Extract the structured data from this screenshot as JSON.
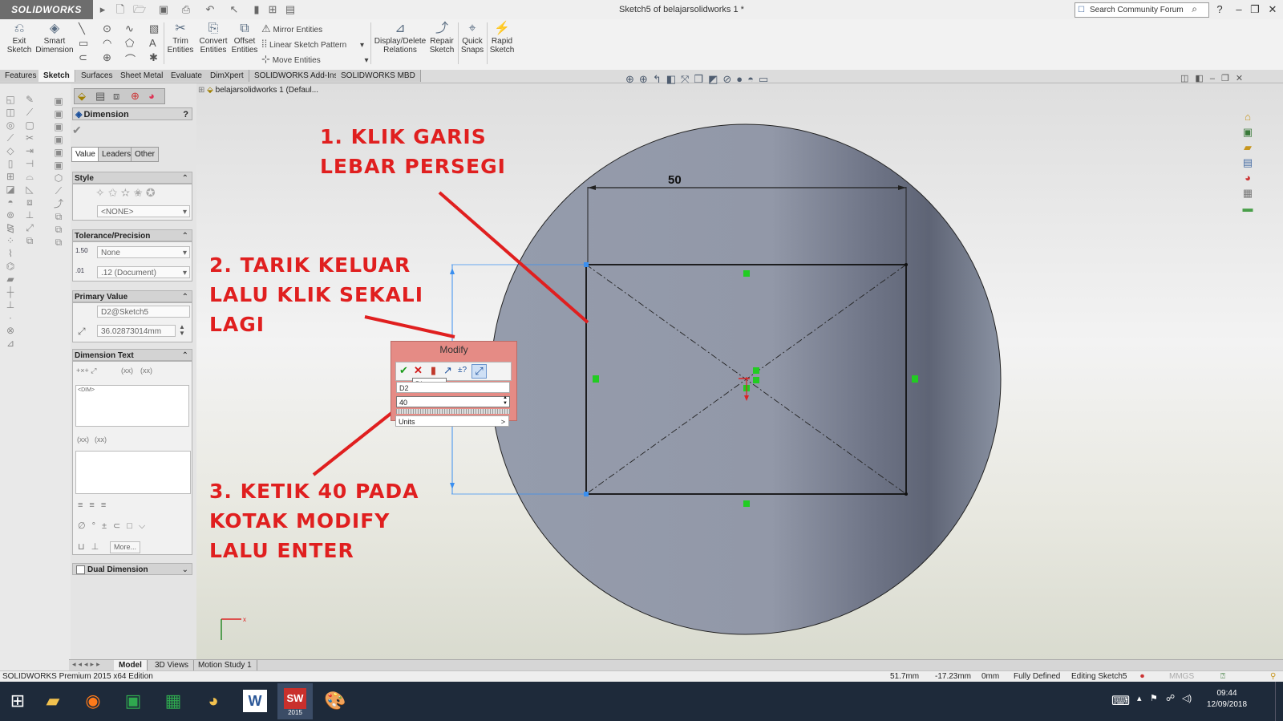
{
  "app": {
    "logo": "SOLIDWORKS",
    "doc_title": "Sketch5 of belajarsolidworks 1 *"
  },
  "search": {
    "placeholder": "Search Community Forum"
  },
  "toolbar": {
    "exit_sketch": "Exit Sketch",
    "smart_dimension": "Smart Dimension",
    "trim_entities": "Trim Entities",
    "convert_entities": "Convert Entities",
    "offset_entities": "Offset Entities",
    "mirror_entities": "Mirror Entities",
    "linear_sketch_pattern": "Linear Sketch Pattern",
    "move_entities": "Move Entities",
    "display_delete_relations": "Display/Delete Relations",
    "repair_sketch": "Repair Sketch",
    "quick_snaps": "Quick Snaps",
    "rapid_sketch": "Rapid Sketch"
  },
  "tabs": [
    "Features",
    "Sketch",
    "Surfaces",
    "Sheet Metal",
    "Evaluate",
    "DimXpert",
    "SOLIDWORKS Add-Ins",
    "SOLIDWORKS MBD"
  ],
  "tree": {
    "root": "belajarsolidworks 1  (Defaul..."
  },
  "pm": {
    "title": "Dimension",
    "help": "?",
    "tabs": [
      "Value",
      "Leaders",
      "Other"
    ],
    "style": {
      "header": "Style",
      "value": "<NONE>"
    },
    "tolerance": {
      "header": "Tolerance/Precision",
      "type": "None",
      "precision": ".12 (Document)",
      "icon1": "1.50",
      "icon2": ".01"
    },
    "primary": {
      "header": "Primary Value",
      "name": "D2@Sketch5",
      "value": "36.02873014mm"
    },
    "dimtext": {
      "header": "Dimension Text",
      "xx1": "(xx)",
      "xx2": "(xx)",
      "dim": "<DIM>",
      "xx3": "(xx)",
      "xx4": "(xx)",
      "more": "More..."
    },
    "dual": {
      "header": "Dual Dimension"
    }
  },
  "sketch": {
    "dimension_value": "50"
  },
  "annotations": {
    "a1_l1": "1. KLIK GARIS",
    "a1_l2": "LEBAR PERSEGI",
    "a2_l1": "2. TARIK KELUAR",
    "a2_l2": "LALU KLIK SEKALI",
    "a2_l3": "LAGI",
    "a3_l1": "3. KETIK 40 PADA",
    "a3_l2": "KOTAK MODIFY",
    "a3_l3": "LALU ENTER"
  },
  "modify": {
    "title": "Modify",
    "tooltip": "Distance",
    "dim_name": "D2",
    "value": "40",
    "units": "Units",
    "units_arrow": ">"
  },
  "bottom_tabs": [
    "Model",
    "3D Views",
    "Motion Study 1"
  ],
  "status": {
    "edition": "SOLIDWORKS Premium 2015 x64 Edition",
    "x": "51.7mm",
    "y": "-17.23mm",
    "z": "0mm",
    "state": "Fully Defined",
    "editing": "Editing Sketch5",
    "units": "MMGS"
  },
  "taskbar": {
    "time": "09:44",
    "date": "12/09/2018",
    "sw_label": "2015"
  },
  "colors": {
    "annotation": "#e01f1f",
    "modify_bg": "#e58b85",
    "circle_fill": "#8e96a7",
    "constraint_green": "#22cc22"
  }
}
